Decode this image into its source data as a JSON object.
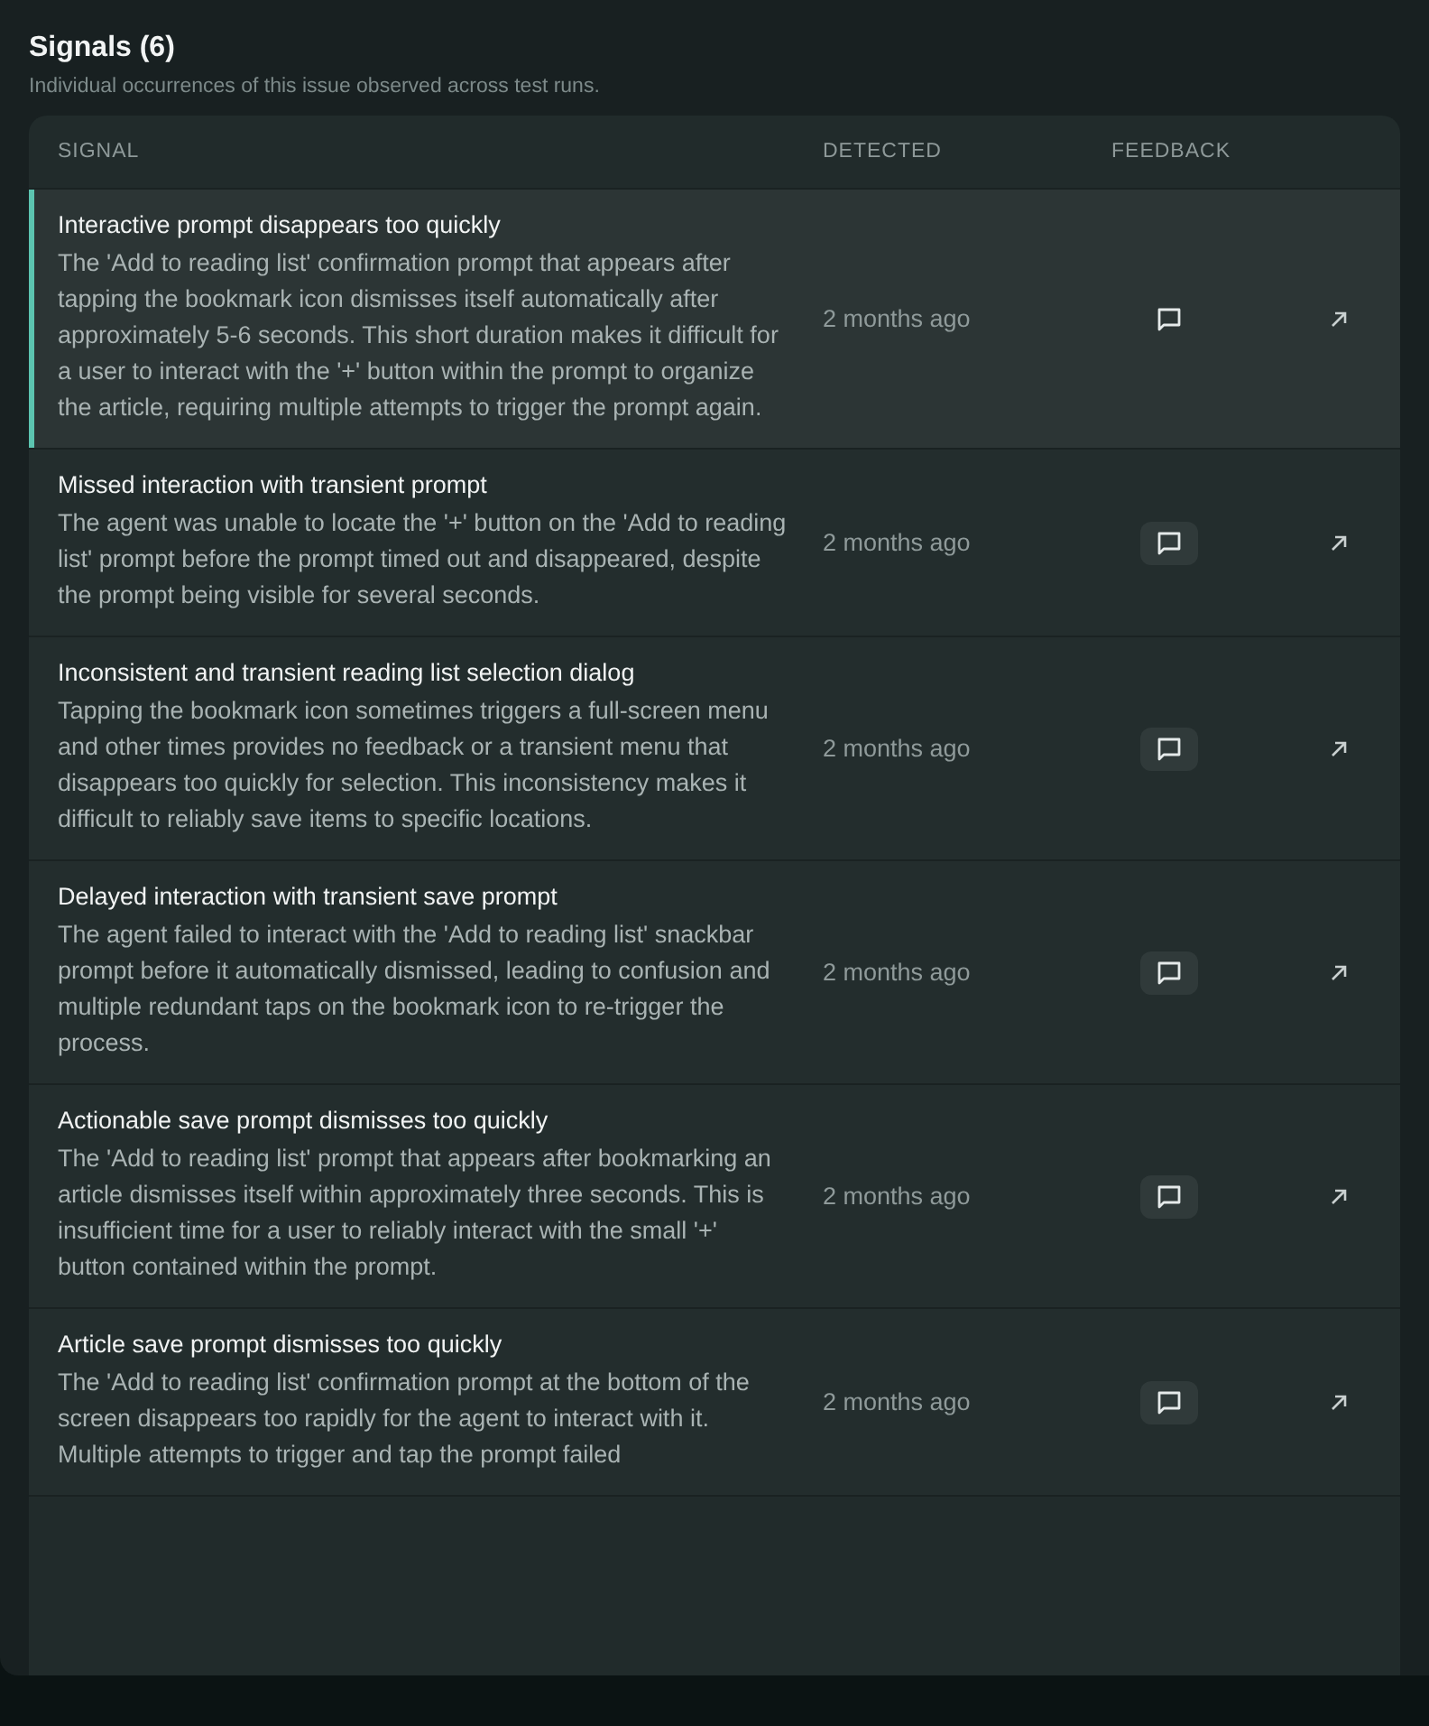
{
  "section": {
    "title": "Signals (6)",
    "subtitle": "Individual occurrences of this issue observed across test runs."
  },
  "table": {
    "columns": [
      "SIGNAL",
      "DETECTED",
      "FEEDBACK"
    ],
    "rows": [
      {
        "title": "Interactive prompt disappears too quickly",
        "description": "The 'Add to reading list' confirmation prompt that appears after tapping the bookmark icon dismisses itself automatically after approximately 5-6 seconds. This short duration makes it difficult for a user to interact with the '+' button within the prompt to organize the article, requiring multiple attempts to trigger the prompt again.",
        "detected": "2 months ago",
        "selected": true
      },
      {
        "title": "Missed interaction with transient prompt",
        "description": "The agent was unable to locate the '+' button on the 'Add to reading list' prompt before the prompt timed out and disappeared, despite the prompt being visible for several seconds.",
        "detected": "2 months ago",
        "selected": false
      },
      {
        "title": "Inconsistent and transient reading list selection dialog",
        "description": "Tapping the bookmark icon sometimes triggers a full-screen menu and other times provides no feedback or a transient menu that disappears too quickly for selection. This inconsistency makes it difficult to reliably save items to specific locations.",
        "detected": "2 months ago",
        "selected": false
      },
      {
        "title": "Delayed interaction with transient save prompt",
        "description": "The agent failed to interact with the 'Add to reading list' snackbar prompt before it automatically dismissed, leading to confusion and multiple redundant taps on the bookmark icon to re-trigger the process.",
        "detected": "2 months ago",
        "selected": false
      },
      {
        "title": "Actionable save prompt dismisses too quickly",
        "description": "The 'Add to reading list' prompt that appears after bookmarking an article dismisses itself within approximately three seconds. This is insufficient time for a user to reliably interact with the small '+' button contained within the prompt.",
        "detected": "2 months ago",
        "selected": false
      },
      {
        "title": "Article save prompt dismisses too quickly",
        "description": "The 'Add to reading list' confirmation prompt at the bottom of the screen disappears too rapidly for the agent to interact with it. Multiple attempts to trigger and tap the prompt failed",
        "detected": "2 months ago",
        "selected": false
      }
    ]
  }
}
